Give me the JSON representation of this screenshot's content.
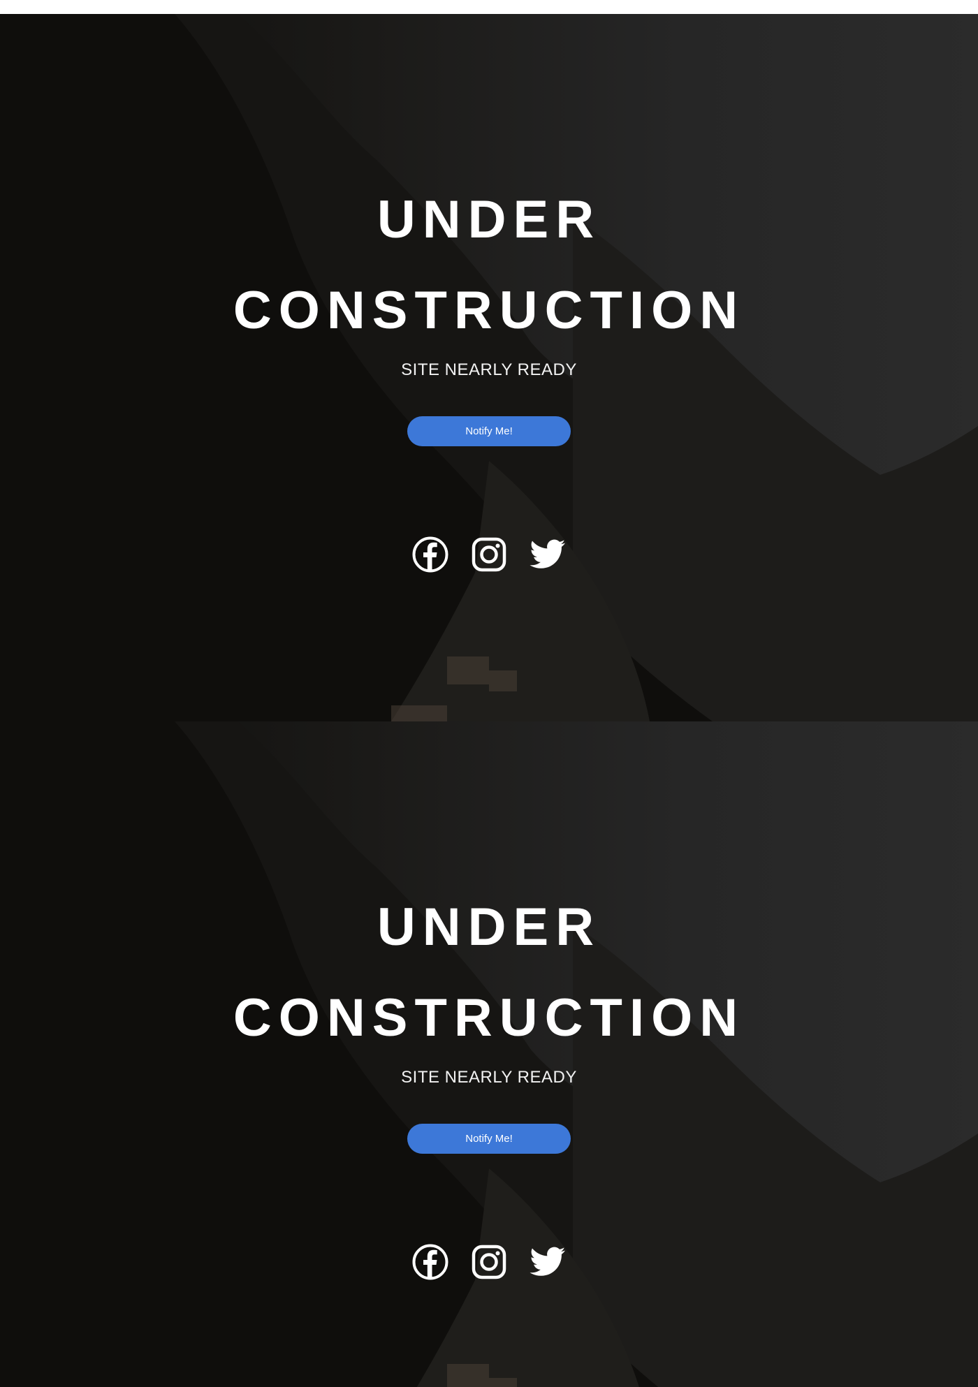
{
  "sections": [
    {
      "title_line1": "UNDER",
      "title_line2": "CONSTRUCTION",
      "subtitle": "SITE NEARLY READY",
      "notify_label": "Notify Me!",
      "social": [
        "facebook-icon",
        "instagram-icon",
        "twitter-icon"
      ]
    },
    {
      "title_line1": "UNDER",
      "title_line2": "CONSTRUCTION",
      "subtitle": "SITE NEARLY READY",
      "notify_label": "Notify Me!",
      "social": [
        "facebook-icon",
        "instagram-icon",
        "twitter-icon"
      ]
    }
  ],
  "colors": {
    "button": "#3d78d8",
    "text": "#ffffff",
    "overlay": "#141312"
  }
}
